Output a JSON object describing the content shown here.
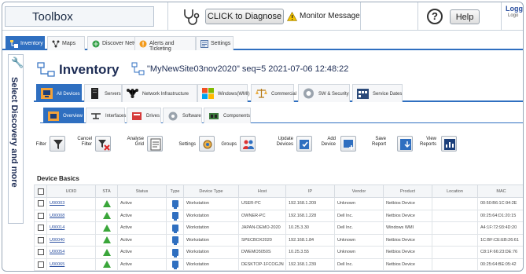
{
  "topbar": {
    "app_title": "Toolbox",
    "diagnose_button": "CLICK to Diagnose",
    "monitor_message": "Monitor Message",
    "help_label": "Help",
    "help_symbol": "?",
    "logged_label": "Logge",
    "logout_label": "Logo"
  },
  "main_tabs": [
    {
      "label": "Inventory",
      "icon": "inventory-icon",
      "active": true
    },
    {
      "label": "Maps",
      "icon": "maps-icon"
    },
    {
      "label": "Discover Network",
      "icon": "discover-icon"
    },
    {
      "label": "Alerts and Ticketing",
      "icon": "alerts-icon"
    },
    {
      "label": "Settings",
      "icon": "settings-icon"
    }
  ],
  "left_panel": {
    "label": "Select Discovery and more"
  },
  "inventory": {
    "title": "Inventory",
    "site_info": "\"MyNewSite03nov2020\" seq=5 2021-07-06 12:48:22"
  },
  "category_tabs": [
    {
      "label": "All Devices",
      "active": true
    },
    {
      "label": "Servers"
    },
    {
      "label": "Network Infrastructure"
    },
    {
      "label": "Windows(WMI)"
    },
    {
      "label": "Commercial"
    },
    {
      "label": "SW & Security"
    },
    {
      "label": "Service Dates"
    }
  ],
  "sub_tabs": [
    {
      "label": "Overview",
      "active": true
    },
    {
      "label": "Interfaces"
    },
    {
      "label": "Drives"
    },
    {
      "label": "Software"
    },
    {
      "label": "Components"
    }
  ],
  "toolbar": {
    "filter": "Filter",
    "cancel_filter_1": "Cancel",
    "cancel_filter_2": "Filter",
    "analyse_grid_1": "Analyse",
    "analyse_grid_2": "Grid",
    "settings": "Settings",
    "groups": "Groups",
    "update_devices_1": "Update",
    "update_devices_2": "Devices",
    "add_device_1": "Add",
    "add_device_2": "Device",
    "save_report_1": "Save",
    "save_report_2": "Report",
    "view_reports_1": "View",
    "view_reports_2": "Reports"
  },
  "table": {
    "section_title": "Device Basics",
    "columns": [
      "UOID",
      "STA",
      "Status",
      "Type",
      "Device Type",
      "Host",
      "IP",
      "Vendor",
      "Product",
      "Location",
      "MAC"
    ],
    "rows": [
      {
        "uoid": "U00003",
        "status": "Active",
        "device_type": "Workstation",
        "host": "USER-PC",
        "ip": "192.168.1.209",
        "vendor": "Unknown",
        "product": "Netbios Device",
        "location": "",
        "mac": "00:50:B6:1C:94:2E"
      },
      {
        "uoid": "U00008",
        "status": "Active",
        "device_type": "Workstation",
        "host": "OWNER-PC",
        "ip": "192.168.1.228",
        "vendor": "Dell Inc.",
        "product": "Netbios Device",
        "location": "",
        "mac": "00:25:64:D1:20:15"
      },
      {
        "uoid": "U00014",
        "status": "Active",
        "device_type": "Workstation",
        "host": "JAPAN-DEMO-2020",
        "ip": "10.25.3.30",
        "vendor": "Dell Inc.",
        "product": "Windows WMI",
        "location": "",
        "mac": "A4:1F:72:93:4D:20"
      },
      {
        "uoid": "U00040",
        "status": "Active",
        "device_type": "Workstation",
        "host": "SPECBOX2020",
        "ip": "192.168.1.84",
        "vendor": "Unknown",
        "product": "Netbios Device",
        "location": "",
        "mac": "1C:BF:CE:EB:26:61"
      },
      {
        "uoid": "U00054",
        "status": "Active",
        "device_type": "Workstation",
        "host": "DWEMO5050S",
        "ip": "10.25.3.55",
        "vendor": "Unknown",
        "product": "Netbios Device",
        "location": "",
        "mac": "C8:1F:66:23:DE:76"
      },
      {
        "uoid": "U00065",
        "status": "Active",
        "device_type": "Workstation",
        "host": "DESKTOP-1FCOGJN",
        "ip": "192.168.1.239",
        "vendor": "Dell Inc.",
        "product": "Netbios Device",
        "location": "",
        "mac": "00:25:64:BE:05:42"
      }
    ]
  },
  "colors": {
    "accent": "#2f6fc0",
    "title_navy": "#1e2d55",
    "status_green": "#3aa63a"
  }
}
